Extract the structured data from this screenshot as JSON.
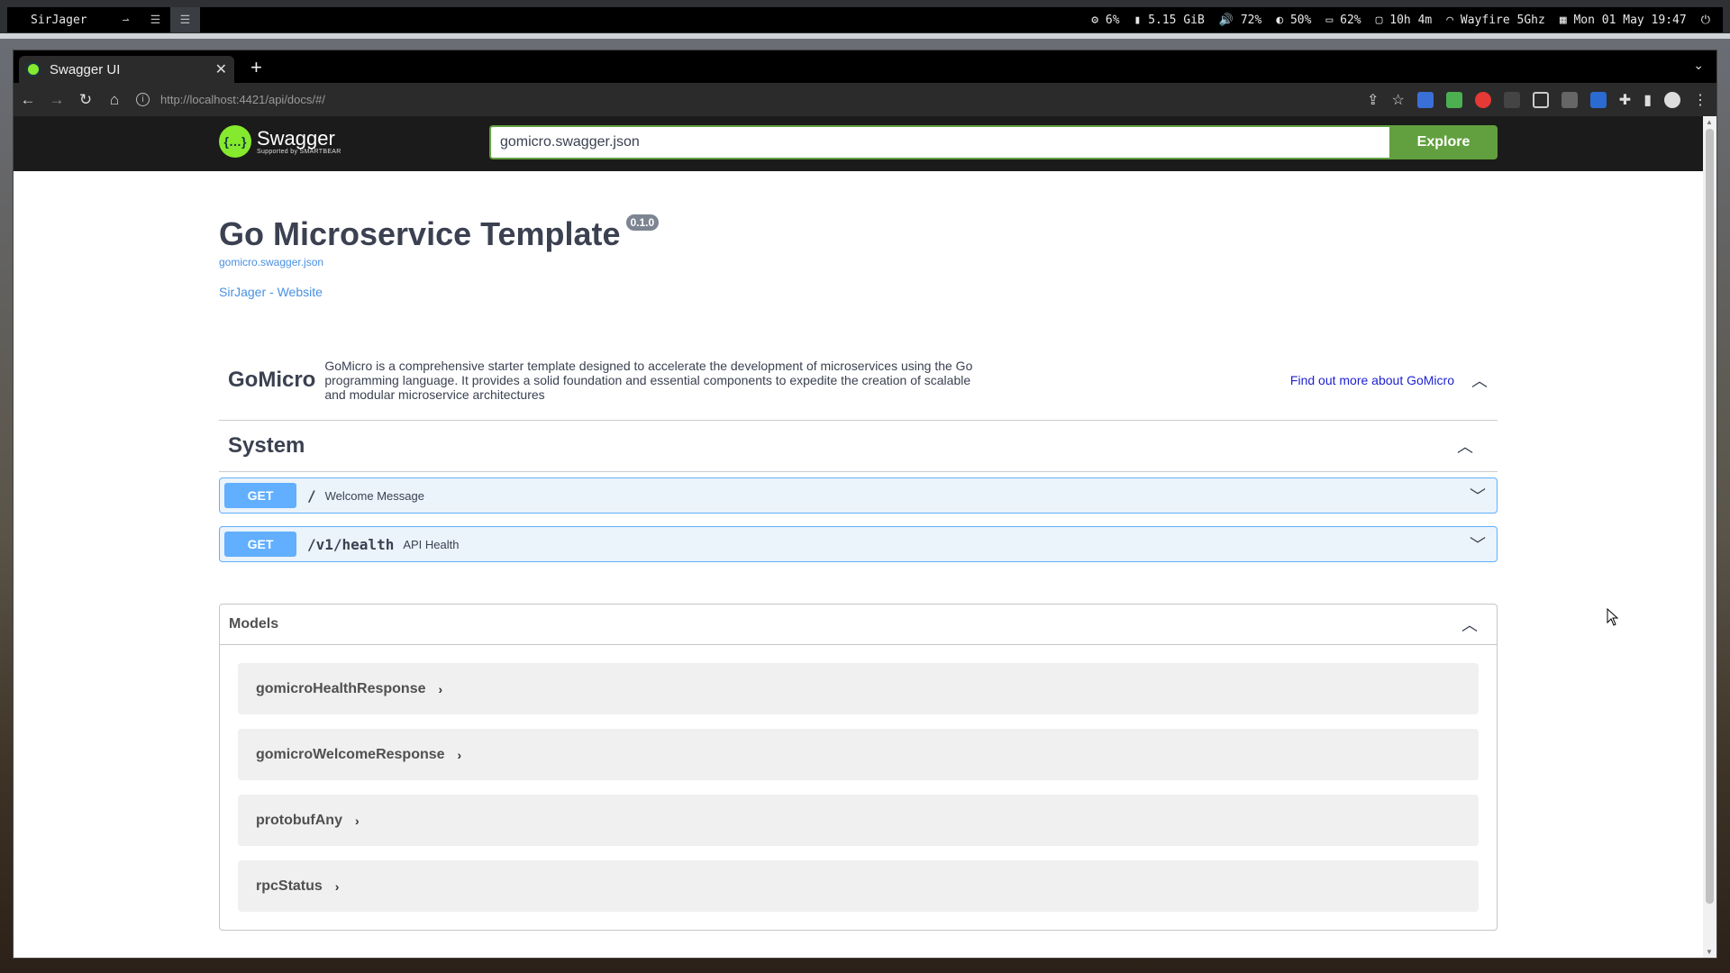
{
  "desktop": {
    "workspace": "SirJager",
    "status": {
      "cpu": "6%",
      "memory": "5.15 GiB",
      "volume": "72%",
      "brightness": "50%",
      "battery": "62%",
      "uptime": "10h 4m",
      "wifi": "Wayfire 5Ghz",
      "datetime": "Mon 01 May 19:47"
    }
  },
  "browser": {
    "tab_title": "Swagger UI",
    "url_host": "http://localhost",
    "url_rest": ":4421/api/docs/#/"
  },
  "swagger": {
    "logo_name": "Swagger",
    "logo_sub": "Supported by SMARTBEAR",
    "spec_url": "gomicro.swagger.json",
    "explore_label": "Explore",
    "title": "Go Microservice Template",
    "version": "0.1.0",
    "spec_link": "gomicro.swagger.json",
    "website_link": "SirJager - Website",
    "tags": [
      {
        "name": "GoMicro",
        "description": "GoMicro is a comprehensive starter template designed to accelerate the development of microservices using the Go programming language. It provides a solid foundation and essential components to expedite the creation of scalable and modular microservice architectures",
        "more": "Find out more about GoMicro"
      },
      {
        "name": "System"
      }
    ],
    "operations": [
      {
        "method": "GET",
        "path": "/",
        "summary": "Welcome Message"
      },
      {
        "method": "GET",
        "path": "/v1/health",
        "summary": "API Health"
      }
    ],
    "models_title": "Models",
    "models": [
      "gomicroHealthResponse",
      "gomicroWelcomeResponse",
      "protobufAny",
      "rpcStatus"
    ]
  }
}
